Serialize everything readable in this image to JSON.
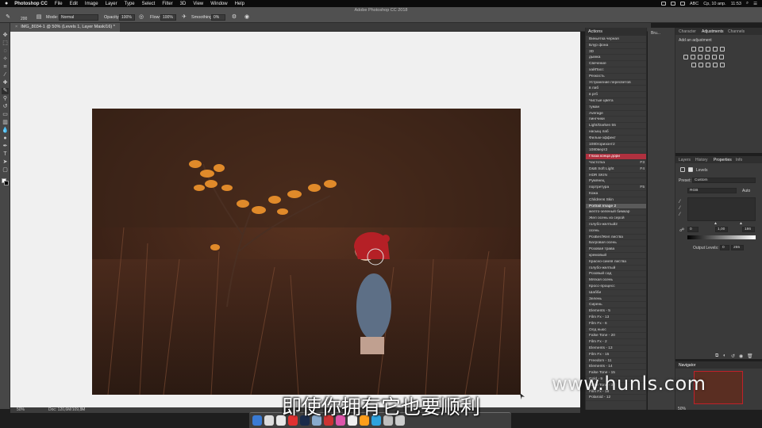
{
  "menubar": {
    "app": "Photoshop CC",
    "items": [
      "File",
      "Edit",
      "Image",
      "Layer",
      "Type",
      "Select",
      "Filter",
      "3D",
      "View",
      "Window",
      "Help"
    ],
    "status_right": [
      "ABC",
      "Ср, 10 апр.",
      "11:53"
    ]
  },
  "options": {
    "app_title": "Adobe Photoshop CC 2018",
    "brush_size": "200",
    "mode_label": "Mode:",
    "mode_value": "Normal",
    "opacity_label": "Opacity:",
    "opacity_value": "100%",
    "flow_label": "Flow:",
    "flow_value": "100%",
    "smoothing_label": "Smoothing:",
    "smoothing_value": "0%"
  },
  "document": {
    "tab_title": "IMG_8034-1 @ 50% (Levels 1, Layer Mask/16) *",
    "zoom": "50%",
    "doc_info": "Doc: 120,6M/109,8M"
  },
  "actions_panel": {
    "title": "Actions",
    "items": [
      {
        "label": "Виньетка черная",
        "key": ""
      },
      {
        "label": "Блур фона",
        "key": ""
      },
      {
        "label": "3D",
        "key": ""
      },
      {
        "label": "дымка",
        "key": ""
      },
      {
        "label": "Свечение",
        "key": ""
      },
      {
        "label": "хайПасс",
        "key": ""
      },
      {
        "label": "Резкость",
        "key": ""
      },
      {
        "label": "Устранение пересветов",
        "key": ""
      },
      {
        "label": "в лаб",
        "key": ""
      },
      {
        "label": "в ргб",
        "key": ""
      },
      {
        "label": "Чистые цвета",
        "key": ""
      },
      {
        "label": "туман",
        "key": ""
      },
      {
        "label": "Average",
        "key": ""
      },
      {
        "label": "пингчики",
        "key": ""
      },
      {
        "label": "Light/Darken 55",
        "key": ""
      },
      {
        "label": "насыщ лаб",
        "key": ""
      },
      {
        "label": "Фильм-эффект",
        "key": ""
      },
      {
        "label": "1080горизонт2",
        "key": ""
      },
      {
        "label": "1080верт2",
        "key": ""
      },
      {
        "label": "Глаза конца дори",
        "key": ""
      },
      {
        "label": "Частотка",
        "key": "F3"
      },
      {
        "label": "D&B Soft Light",
        "key": "F4"
      },
      {
        "label": "HDR SKIN",
        "key": ""
      },
      {
        "label": "Румянец",
        "key": ""
      },
      {
        "label": "портретура",
        "key": "F5"
      },
      {
        "label": "Кожа",
        "key": ""
      },
      {
        "label": "Childrens Skin",
        "key": ""
      },
      {
        "label": "Portrait Image 2",
        "key": ""
      },
      {
        "label": "желто-зеленый бимкар",
        "key": ""
      },
      {
        "label": "Жел осень из серой",
        "key": ""
      },
      {
        "label": "голубо-желтый2",
        "key": ""
      },
      {
        "label": "осень",
        "key": ""
      },
      {
        "label": "РозБег/Жел листва",
        "key": ""
      },
      {
        "label": "Багровая осень",
        "key": ""
      },
      {
        "label": "Розовая трава",
        "key": ""
      },
      {
        "label": "кремовый",
        "key": ""
      },
      {
        "label": "Красно-синяя листва",
        "key": ""
      },
      {
        "label": "голубо-желтый",
        "key": ""
      },
      {
        "label": "Розовый сад",
        "key": ""
      },
      {
        "label": "Мягкая осень",
        "key": ""
      },
      {
        "label": "Кросс-процесс",
        "key": ""
      },
      {
        "label": "Шабби",
        "key": ""
      },
      {
        "label": "Зелень",
        "key": ""
      },
      {
        "label": "Сирень",
        "key": ""
      },
      {
        "label": "Elements - 5",
        "key": ""
      },
      {
        "label": "Film Fx - 13",
        "key": ""
      },
      {
        "label": "Film Fx - 6",
        "key": ""
      },
      {
        "label": "Олд ньюс",
        "key": ""
      },
      {
        "label": "False Tone - 20",
        "key": ""
      },
      {
        "label": "Film Fx - 2",
        "key": ""
      },
      {
        "label": "Elements - 13",
        "key": ""
      },
      {
        "label": "Film Fx - 15",
        "key": ""
      },
      {
        "label": "Freedom - 11",
        "key": ""
      },
      {
        "label": "Elements - 14",
        "key": ""
      },
      {
        "label": "False Tone - 15",
        "key": ""
      },
      {
        "label": "Gold - 9",
        "key": ""
      },
      {
        "label": "False Tone - 3",
        "key": ""
      },
      {
        "label": "Film Fx - 18",
        "key": ""
      },
      {
        "label": "Polaroid - 12",
        "key": ""
      }
    ],
    "red_index": 19,
    "selected_index": 27
  },
  "strip": {
    "label": "Bru..."
  },
  "adjustments_panel": {
    "tabs": [
      "Character",
      "Adjustments",
      "Channels"
    ],
    "active_tab": "Adjustments",
    "title": "Add an adjustment"
  },
  "properties_panel": {
    "tabs": [
      "Layers",
      "History",
      "Properties",
      "Info"
    ],
    "active_tab": "Properties",
    "layer_type": "Levels",
    "preset_label": "Preset:",
    "preset_value": "Custom",
    "channel": "RGB",
    "auto_label": "Auto",
    "input_black": "0",
    "input_gamma": "1,00",
    "input_white": "186",
    "output_label": "Output Levels:",
    "output_black": "0",
    "output_white": "255"
  },
  "navigator_panel": {
    "title": "Navigator",
    "zoom": "50%"
  },
  "watermark": "www.hunls.com",
  "subtitle": "即使你拥有它也要顺利"
}
